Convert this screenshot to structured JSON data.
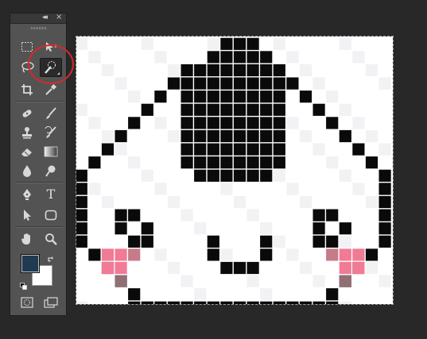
{
  "panel": {
    "collapse_label": "◂◂",
    "close_label": "×"
  },
  "tools": [
    {
      "name": "rectangular-marquee-icon",
      "active": false
    },
    {
      "name": "move-icon",
      "active": false
    },
    {
      "name": "lasso-icon",
      "active": false
    },
    {
      "name": "quick-selection-icon",
      "active": true
    },
    {
      "name": "crop-icon",
      "active": false
    },
    {
      "name": "eyedropper-icon",
      "active": false
    },
    {
      "name": "spot-healing-icon",
      "active": false
    },
    {
      "name": "brush-icon",
      "active": false
    },
    {
      "name": "clone-stamp-icon",
      "active": false
    },
    {
      "name": "history-brush-icon",
      "active": false
    },
    {
      "name": "eraser-icon",
      "active": false
    },
    {
      "name": "gradient-icon",
      "active": false
    },
    {
      "name": "blur-icon",
      "active": false
    },
    {
      "name": "dodge-icon",
      "active": false
    },
    {
      "name": "pen-icon",
      "active": false
    },
    {
      "name": "type-icon",
      "active": false
    },
    {
      "name": "path-selection-icon",
      "active": false
    },
    {
      "name": "shape-icon",
      "active": false
    },
    {
      "name": "hand-icon",
      "active": false
    },
    {
      "name": "zoom-icon",
      "active": false
    },
    {
      "name": "quick-mask-icon",
      "active": false
    },
    {
      "name": "screen-mode-icon",
      "active": false
    }
  ],
  "type_tool_glyph": "T",
  "colors": {
    "foreground": "#1f3a52",
    "background": "#ffffff",
    "highlight_ring": "#d42a2a",
    "pixel_black": "#0a0a0a",
    "blush": "#f17a95"
  },
  "canvas": {
    "description_tag": "onigiri-pixel-art"
  }
}
